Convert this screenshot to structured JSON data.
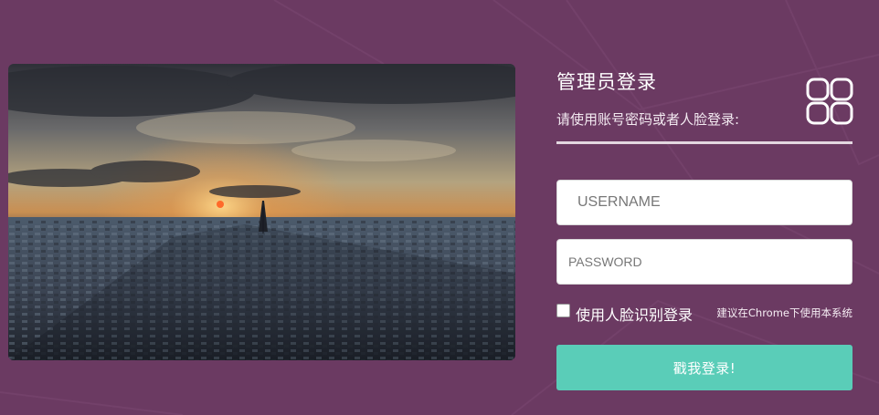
{
  "login": {
    "title": "管理员登录",
    "subtitle": "请使用账号密码或者人脸登录:",
    "username_placeholder": "USERNAME",
    "password_placeholder": "PASSWORD",
    "face_login_label": "使用人脸识别登录",
    "face_login_checked": false,
    "browser_hint": "建议在Chrome下使用本系统",
    "submit_label": "戳我登录!"
  },
  "icons": {
    "logo": "four-rounded-squares-icon"
  },
  "colors": {
    "background": "#6b3a62",
    "button": "#5acdb8",
    "divider": "#e3d7e0",
    "text": "#ffffff"
  }
}
